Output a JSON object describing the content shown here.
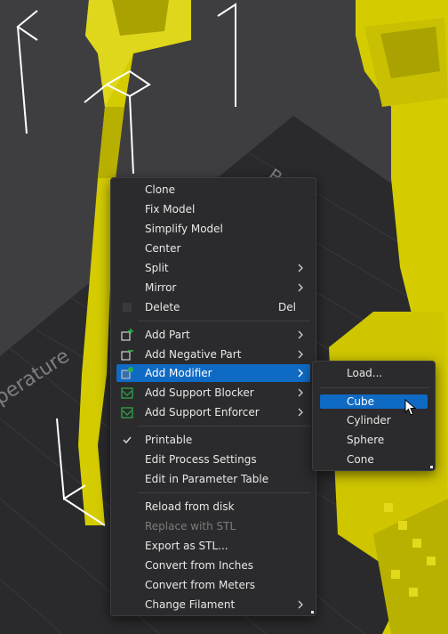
{
  "context_menu": {
    "items": [
      {
        "label": "Clone"
      },
      {
        "label": "Fix Model"
      },
      {
        "label": "Simplify Model"
      },
      {
        "label": "Center"
      },
      {
        "label": "Split"
      },
      {
        "label": "Mirror"
      },
      {
        "label": "Delete",
        "shortcut": "Del"
      },
      {
        "label": "Add Part"
      },
      {
        "label": "Add Negative Part"
      },
      {
        "label": "Add Modifier"
      },
      {
        "label": "Add Support Blocker"
      },
      {
        "label": "Add Support Enforcer"
      },
      {
        "label": "Printable"
      },
      {
        "label": "Edit Process Settings"
      },
      {
        "label": "Edit in Parameter Table"
      },
      {
        "label": "Reload from disk"
      },
      {
        "label": "Replace with STL"
      },
      {
        "label": "Export as STL..."
      },
      {
        "label": "Convert from Inches"
      },
      {
        "label": "Convert from Meters"
      },
      {
        "label": "Change Filament"
      }
    ]
  },
  "modifier_submenu": {
    "items": [
      {
        "label": "Load..."
      },
      {
        "label": "Cube"
      },
      {
        "label": "Cylinder"
      },
      {
        "label": "Sphere"
      },
      {
        "label": "Cone"
      }
    ]
  },
  "colors": {
    "highlight": "#0f6ac4",
    "menu_bg": "#2b2b2d",
    "model_yellow": "#d4cc00",
    "bed_dark": "#2a2a2c",
    "icon_green": "#2fae4a"
  },
  "icons": {
    "add_part": "plus-part-icon",
    "add_negative_part": "minus-part-icon",
    "add_modifier": "modifier-icon",
    "support_blocker": "support-blocker-icon",
    "support_enforcer": "support-enforcer-icon",
    "printable": "checkmark-icon",
    "submenu": "chevron-right-icon",
    "cursor": "mouse-pointer-icon"
  }
}
